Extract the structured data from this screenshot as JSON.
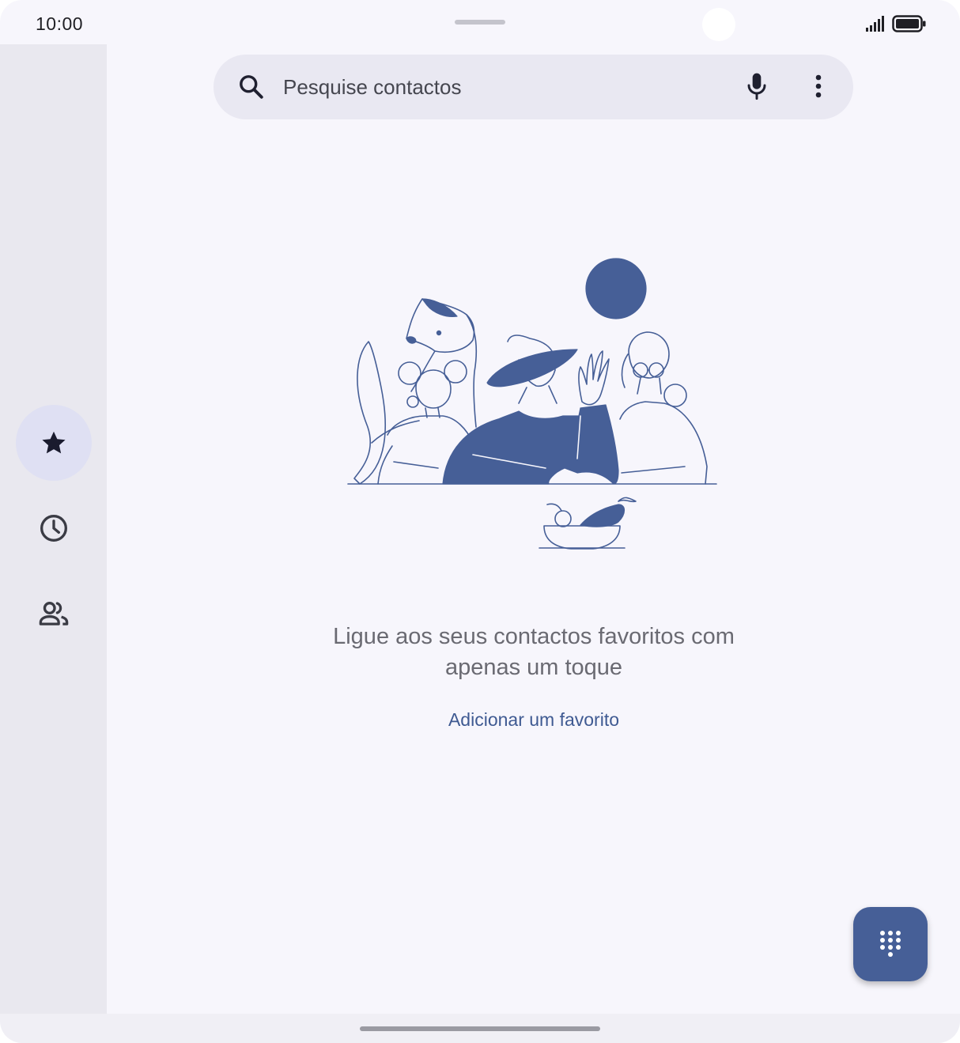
{
  "status_bar": {
    "time": "10:00",
    "icons": [
      "signal-icon",
      "battery-icon"
    ]
  },
  "search": {
    "placeholder": "Pesquise contactos",
    "value": "",
    "icons": [
      "search-icon",
      "mic-icon",
      "more-vert-icon"
    ]
  },
  "nav_rail": {
    "items": [
      {
        "id": "favorites",
        "icon": "star-icon",
        "active": true
      },
      {
        "id": "recents",
        "icon": "clock-icon",
        "active": false
      },
      {
        "id": "contacts",
        "icon": "people-icon",
        "active": false
      }
    ]
  },
  "empty_state": {
    "message": "Ligue aos seus contactos favoritos com apenas um toque",
    "action_label": "Adicionar um favorito"
  },
  "fab": {
    "icon": "dialpad-icon"
  },
  "colors": {
    "accent": "#465f97",
    "link": "#3f5a92",
    "background": "#f7f6fc",
    "rail": "#e9e8ef",
    "active_indicator": "#dfe0f3"
  }
}
